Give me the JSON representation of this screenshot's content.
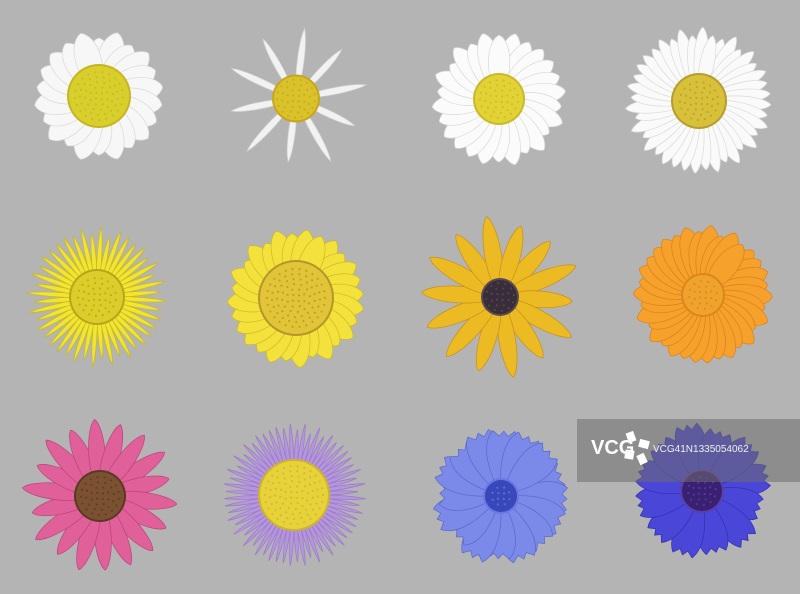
{
  "watermark": {
    "brand": "VCG",
    "id_text": "VCG41N1335054062"
  },
  "flowers": [
    {
      "name": "white-chamomile-flower",
      "petals": 22,
      "petal_color": "#f7f7f7",
      "petal_stroke": "#d8d8d8",
      "center_color": "#d8cf2c",
      "center_ring": "#c7b520"
    },
    {
      "name": "white-thin-petal-flower",
      "petals": 10,
      "petal_color": "#f2f2f2",
      "petal_stroke": "#cfcfcf",
      "center_color": "#d9c22a",
      "center_ring": "#c7a51f"
    },
    {
      "name": "white-daisy-flower",
      "petals": 26,
      "petal_color": "#fbfbfb",
      "petal_stroke": "#d9d9d9",
      "center_color": "#e3d234",
      "center_ring": "#cbb82a"
    },
    {
      "name": "white-aster-flower",
      "petals": 40,
      "petal_color": "#fafafa",
      "petal_stroke": "#dadada",
      "center_color": "#d7c03a",
      "center_ring": "#b89c2c"
    },
    {
      "name": "yellow-thin-ray-flower",
      "petals": 44,
      "petal_color": "#f1e432",
      "petal_stroke": "#c9b91c",
      "center_color": "#dccd2a",
      "center_ring": "#b8a51c"
    },
    {
      "name": "yellow-daisy-flower",
      "petals": 28,
      "petal_color": "#f4e23c",
      "petal_stroke": "#cdb922",
      "center_color": "#e2c437",
      "center_ring": "#b6962a"
    },
    {
      "name": "black-eyed-susan-flower",
      "petals": 14,
      "petal_color": "#ecba22",
      "petal_stroke": "#c49018",
      "center_color": "#3a2d3a",
      "center_ring": "#5a4a52"
    },
    {
      "name": "orange-marigold-flower",
      "petals": 34,
      "petal_color": "#f5a12b",
      "petal_stroke": "#d9801c",
      "center_color": "#f0a32c",
      "center_ring": "#d8871e"
    },
    {
      "name": "pink-coneflower-flower",
      "petals": 18,
      "petal_color": "#e0609a",
      "petal_stroke": "#b8437a",
      "center_color": "#7a5232",
      "center_ring": "#5a3a22"
    },
    {
      "name": "lavender-aster-flower",
      "petals": 60,
      "petal_color": "#b596de",
      "petal_stroke": "#9a78c8",
      "center_color": "#e8d23a",
      "center_ring": "#cdb52a"
    },
    {
      "name": "blue-chicory-flower",
      "petals": 16,
      "petal_color": "#7b8ae8",
      "petal_stroke": "#5a66c8",
      "center_color": "#3848b8",
      "center_ring": "#6a78e0"
    },
    {
      "name": "blue-cornflower-flower",
      "petals": 12,
      "petal_color": "#4a46d8",
      "petal_stroke": "#322eb0",
      "center_color": "#3a2070",
      "center_ring": "#5a40a8"
    }
  ]
}
